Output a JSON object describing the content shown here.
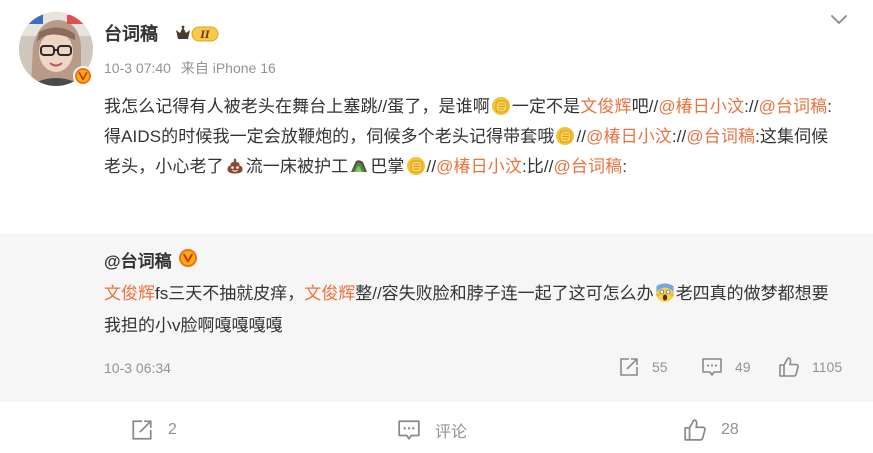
{
  "post": {
    "author": "台词稿",
    "level_badge": "II",
    "time": "10-3 07:40",
    "source": "来自 iPhone 16",
    "text": [
      {
        "t": "text",
        "v": "我怎么记得有人被老头在舞台上塞跳//蛋了，是谁啊"
      },
      {
        "t": "emoji",
        "name": "fist-emoji"
      },
      {
        "t": "text",
        "v": "一定不是"
      },
      {
        "t": "hl",
        "v": "文俊辉"
      },
      {
        "t": "text",
        "v": "吧//"
      },
      {
        "t": "mention",
        "v": "@椿日小汶"
      },
      {
        "t": "text",
        "v": "://"
      },
      {
        "t": "mention",
        "v": "@台词稿"
      },
      {
        "t": "text",
        "v": ":得AIDS的时候我一定会放鞭炮的，伺候多个老头记得带套哦"
      },
      {
        "t": "emoji",
        "name": "fist-emoji"
      },
      {
        "t": "text",
        "v": "//"
      },
      {
        "t": "mention",
        "v": "@椿日小汶"
      },
      {
        "t": "text",
        "v": "://"
      },
      {
        "t": "mention",
        "v": "@台词稿"
      },
      {
        "t": "text",
        "v": ":这集伺候老头，小心老了"
      },
      {
        "t": "emoji",
        "name": "poop-emoji"
      },
      {
        "t": "text",
        "v": "流一床被护工"
      },
      {
        "t": "emoji",
        "name": "slap-hand-emoji"
      },
      {
        "t": "text",
        "v": "巴掌"
      },
      {
        "t": "emoji",
        "name": "fist-emoji"
      },
      {
        "t": "text",
        "v": "//"
      },
      {
        "t": "mention",
        "v": "@椿日小汶"
      },
      {
        "t": "text",
        "v": ":比//"
      },
      {
        "t": "mention",
        "v": "@台词稿"
      },
      {
        "t": "text",
        "v": ":"
      }
    ]
  },
  "retweet": {
    "author": "@台词稿",
    "text": [
      {
        "t": "hl",
        "v": "文俊辉"
      },
      {
        "t": "text",
        "v": "fs三天不抽就皮痒，"
      },
      {
        "t": "hl",
        "v": "文俊辉"
      },
      {
        "t": "text",
        "v": "整//容失败脸和脖子连一起了这可怎么办"
      },
      {
        "t": "emoji",
        "name": "scream-emoji"
      },
      {
        "t": "text",
        "v": "老四真的做梦都想要我担的小v脸啊嘎嘎嘎嘎"
      }
    ],
    "time": "10-3 06:34",
    "reposts": "55",
    "comments": "49",
    "likes": "1105"
  },
  "toolbar": {
    "reposts": "2",
    "comment_label": "评论",
    "likes": "28"
  },
  "colors": {
    "mention": "#eb7340",
    "muted": "#939393",
    "retweet_bg": "#f6f6f6"
  }
}
